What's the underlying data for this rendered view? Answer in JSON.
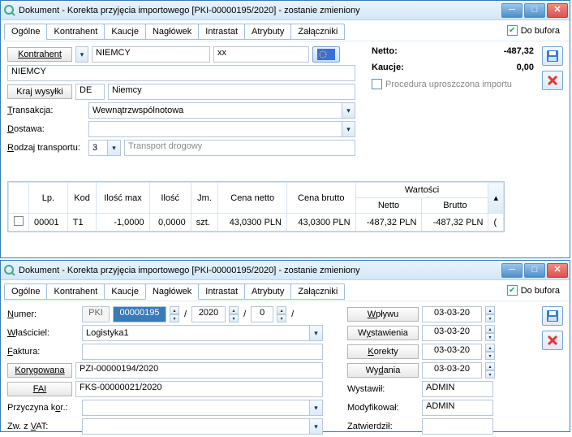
{
  "win1": {
    "title": "Dokument - Korekta przyjęcia importowego [PKI-00000195/2020]  - zostanie zmieniony",
    "tabs": [
      "Ogólne",
      "Kontrahent",
      "Kaucje",
      "Nagłówek",
      "Intrastat",
      "Atrybuty",
      "Załączniki"
    ],
    "active_tab": 0,
    "do_bufora": "Do bufora",
    "kontrahent_btn": "Kontrahent",
    "kontrahent_val": "NIEMCY",
    "kontrahent_xx": "xx",
    "kontrahent_name": "NIEMCY",
    "kraj_btn": "Kraj wysyłki",
    "kraj_code": "DE",
    "kraj_name": "Niemcy",
    "transakcja_lbl": "Transakcja:",
    "transakcja_val": "Wewnątrzwspólnotowa",
    "dostawa_lbl": "Dostawa:",
    "rodzaj_lbl": "Rodzaj transportu:",
    "rodzaj_num": "3",
    "rodzaj_txt": "Transport drogowy",
    "procedura_lbl": "Procedura uproszczona importu",
    "totals": {
      "netto_lbl": "Netto:",
      "netto_val": "-487,32",
      "kaucje_lbl": "Kaucje:",
      "kaucje_val": "0,00"
    },
    "grid": {
      "headers": {
        "lp": "Lp.",
        "kod": "Kod",
        "iloscmax": "Ilość max",
        "ilosc": "Ilość",
        "jm": "Jm.",
        "cenanetto": "Cena netto",
        "cenabrutto": "Cena brutto",
        "wartosci": "Wartości",
        "netto": "Netto",
        "brutto": "Brutto"
      },
      "rows": [
        {
          "lp": "00001",
          "kod": "T1",
          "iloscmax": "-1,0000",
          "ilosc": "0,0000",
          "jm": "szt.",
          "cenanetto": "43,0300 PLN",
          "cenabrutto": "43,0300 PLN",
          "netto": "-487,32 PLN",
          "brutto": "-487,32 PLN",
          "tail": "("
        }
      ]
    }
  },
  "win2": {
    "title": "Dokument - Korekta przyjęcia importowego [PKI-00000195/2020]  - zostanie zmieniony",
    "tabs": [
      "Ogólne",
      "Kontrahent",
      "Kaucje",
      "Nagłówek",
      "Intrastat",
      "Atrybuty",
      "Załączniki"
    ],
    "active_tab": 3,
    "do_bufora": "Do bufora",
    "numer_lbl": "Numer:",
    "numer_code": "PKI",
    "numer_seq": "00000195",
    "numer_year": "2020",
    "numer_zero": "0",
    "wlasciciel_lbl": "Właściciel:",
    "wlasciciel_val": "Logistyka1",
    "faktura_lbl": "Faktura:",
    "korygowana_lbl": "Korygowana",
    "korygowana_val": "PZI-00000194/2020",
    "fai_lbl": "FAI",
    "fai_val": "FKS-00000021/2020",
    "przyczyna_lbl": "Przyczyna kor.:",
    "zwvat_lbl": "Zw. z VAT:",
    "right_btns": {
      "wplywu": "Wpływu",
      "wystawienia": "Wystawienia",
      "korekty": "Korekty",
      "wydania": "Wydania"
    },
    "right_dates": {
      "wplywu": "03-03-20",
      "wystawienia": "03-03-20",
      "korekty": "03-03-20",
      "wydania": "03-03-20"
    },
    "right_labels": {
      "wystawil": "Wystawił:",
      "modyfikowal": "Modyfikował:",
      "zatwierdzil": "Zatwierdził:"
    },
    "right_vals": {
      "wystawil": "ADMIN",
      "modyfikowal": "ADMIN",
      "zatwierdzil": ""
    }
  }
}
